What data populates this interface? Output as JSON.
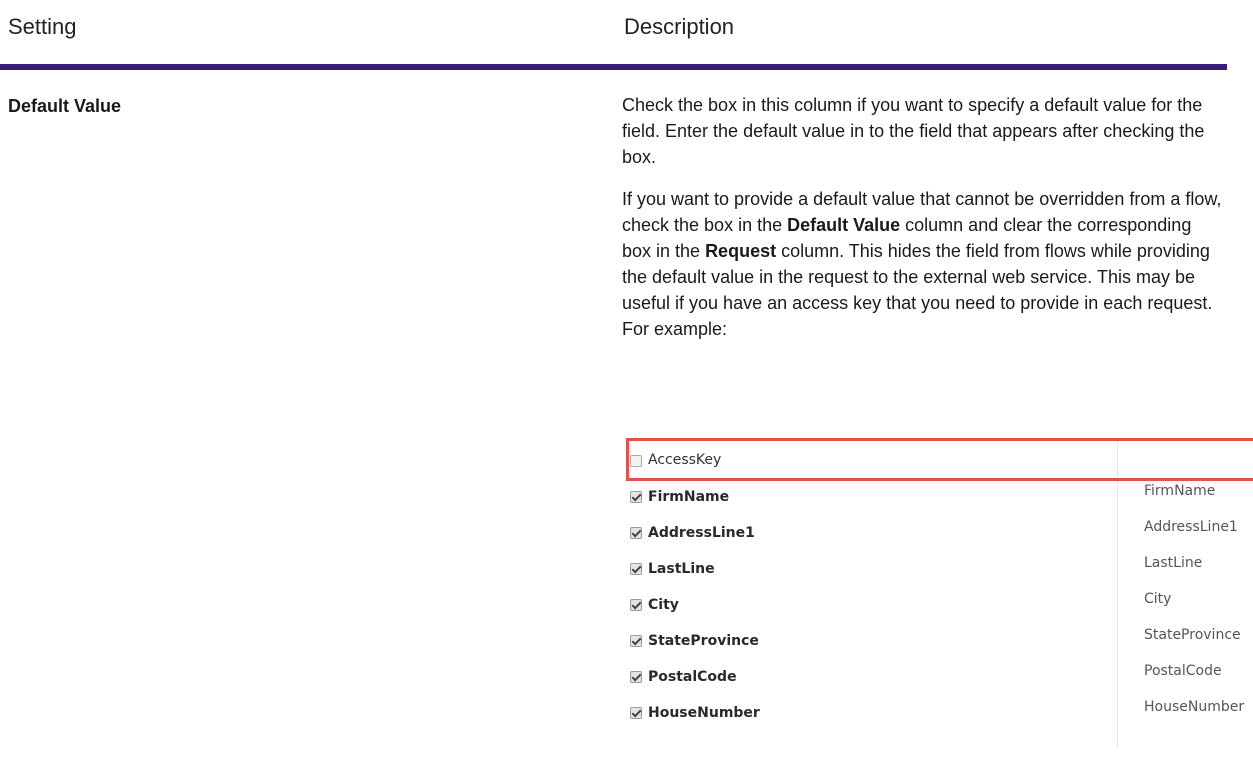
{
  "header": {
    "setting": "Setting",
    "description": "Description"
  },
  "accent_color": "#3c1a78",
  "highlight_color": "#e4504b",
  "row": {
    "setting": "Default Value",
    "para1": "Check the box in this column if you want to specify a default value for the field. Enter the default value in to the field that appears after checking the box.",
    "para2": {
      "t1": "If you want to provide a default value that cannot be overridden from a flow, check the box in the ",
      "b1": "Default Value",
      "t2": " column and clear the corresponding box in the ",
      "b2": "Request",
      "t3": " column. This hides the field from flows while providing the default value in the request to the external web service. This may be useful if you have an access key that you need to provide in each request. For example:"
    }
  },
  "example": {
    "highlighted": {
      "label": "AccessKey",
      "checked": false,
      "value": ""
    },
    "fields": [
      {
        "label": "FirmName",
        "checked": true,
        "value": "FirmName"
      },
      {
        "label": "AddressLine1",
        "checked": true,
        "value": "AddressLine1"
      },
      {
        "label": "LastLine",
        "checked": true,
        "value": "LastLine"
      },
      {
        "label": "City",
        "checked": true,
        "value": "City"
      },
      {
        "label": "StateProvince",
        "checked": true,
        "value": "StateProvince"
      },
      {
        "label": "PostalCode",
        "checked": true,
        "value": "PostalCode"
      },
      {
        "label": "HouseNumber",
        "checked": true,
        "value": "HouseNumber"
      }
    ]
  }
}
